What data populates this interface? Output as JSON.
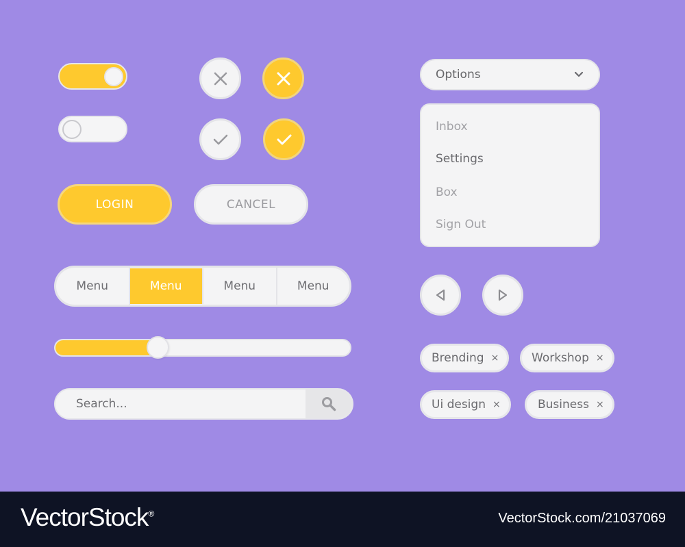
{
  "colors": {
    "background": "#9f8ae5",
    "accent": "#fec92e",
    "surface": "#f4f4f5",
    "border": "#e4e4e8",
    "text": "#6a6a6e",
    "muted_text": "#a2a2a6",
    "footer": "#0e1324"
  },
  "toggles": [
    {
      "state": "on"
    },
    {
      "state": "off"
    }
  ],
  "icon_buttons": [
    {
      "icon": "close-icon",
      "style": "light"
    },
    {
      "icon": "close-icon",
      "style": "accent"
    },
    {
      "icon": "check-icon",
      "style": "light"
    },
    {
      "icon": "check-icon",
      "style": "accent"
    }
  ],
  "buttons": {
    "login_label": "LOGIN",
    "cancel_label": "CANCEL"
  },
  "segmented_menu": {
    "items": [
      "Menu",
      "Menu",
      "Menu",
      "Menu"
    ],
    "active_index": 1
  },
  "slider": {
    "value_fraction": 0.31
  },
  "search": {
    "placeholder": "Search...",
    "button_icon": "search-icon"
  },
  "dropdown": {
    "selected": "Options",
    "icon": "chevron-down-icon",
    "items": [
      "Inbox",
      "Settings",
      "Box",
      "Sign Out"
    ],
    "highlighted_index": 1
  },
  "pager": {
    "prev_icon": "triangle-left-icon",
    "next_icon": "triangle-right-icon"
  },
  "tags": [
    {
      "label": "Brending",
      "remove": "×"
    },
    {
      "label": "Workshop",
      "remove": "×"
    },
    {
      "label": "Ui design",
      "remove": "×"
    },
    {
      "label": "Business",
      "remove": "×"
    }
  ],
  "footer": {
    "brand": "VectorStock",
    "registered": "®",
    "credit": "VectorStock.com/21037069"
  }
}
